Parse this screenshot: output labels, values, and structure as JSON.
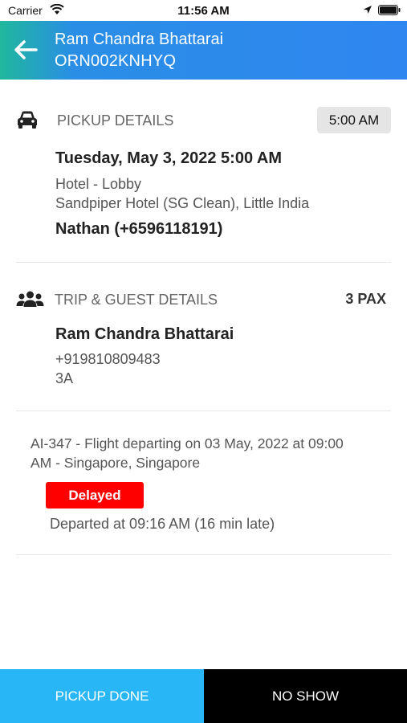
{
  "status_bar": {
    "carrier": "Carrier",
    "time": "11:56 AM"
  },
  "header": {
    "title": "Ram Chandra Bhattarai",
    "subtitle": "ORN002KNHYQ",
    "gradient_start": "#1fb89c",
    "gradient_end": "#2f86f0"
  },
  "pickup": {
    "heading": "PICKUP DETAILS",
    "time_badge": "5:00 AM",
    "datetime": "Tuesday, May 3, 2022 5:00 AM",
    "location_line1": "Hotel - Lobby",
    "location_line2": "Sandpiper Hotel (SG Clean), Little India",
    "contact": "Nathan (+6596118191)"
  },
  "trip": {
    "heading": "TRIP & GUEST DETAILS",
    "pax": "3 PAX",
    "guest_name": "Ram Chandra Bhattarai",
    "guest_phone": "+919810809483",
    "guest_room": "3A"
  },
  "flight": {
    "line1": "AI-347 - Flight departing on 03 May, 2022 at 09:00",
    "line2": "AM - Singapore, Singapore",
    "status": "Delayed",
    "status_color": "#ff0000",
    "departed": "Departed at 09:16 AM (16 min late)"
  },
  "footer": {
    "pickup_done": "PICKUP DONE",
    "no_show": "NO SHOW",
    "pickup_color": "#29b6f6",
    "noshow_color": "#000000"
  }
}
